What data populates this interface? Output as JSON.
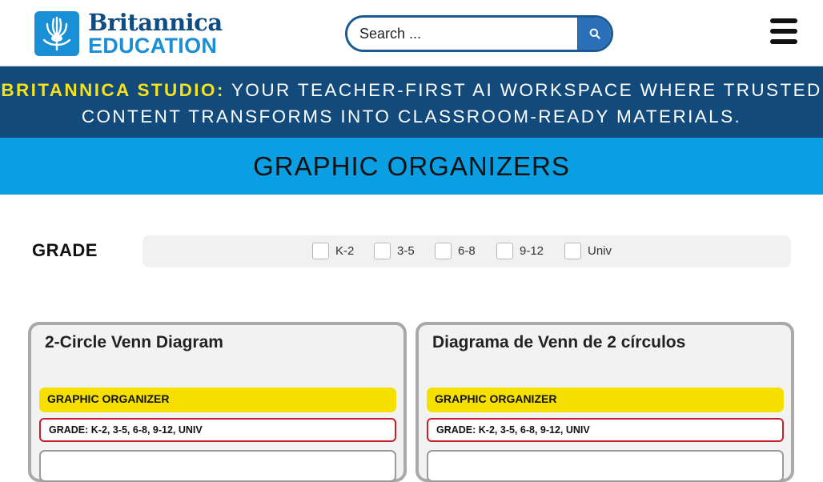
{
  "header": {
    "logo": {
      "line1": "Britannica",
      "line2": "EDUCATION",
      "icon": "britannica-thistle-logo"
    },
    "search": {
      "placeholder": "Search ...",
      "button_icon": "search-icon"
    },
    "menu_icon": "hamburger-menu-icon"
  },
  "banner": {
    "highlight": "BRITANNICA STUDIO:",
    "text": " YOUR TEACHER-FIRST AI WORKSPACE WHERE TRUSTED CONTENT TRANSFORMS INTO CLASSROOM-READY MATERIALS."
  },
  "page_title": "GRAPHIC ORGANIZERS",
  "filters": {
    "label": "GRADE",
    "options": [
      {
        "label": "K-2",
        "checked": false
      },
      {
        "label": "3-5",
        "checked": false
      },
      {
        "label": "6-8",
        "checked": false
      },
      {
        "label": "9-12",
        "checked": false
      },
      {
        "label": "Univ",
        "checked": false
      }
    ]
  },
  "cards": [
    {
      "title": "2-Circle Venn Diagram",
      "type_tag": "GRAPHIC ORGANIZER",
      "grade_tag": "GRADE: K-2, 3-5, 6-8, 9-12, UNIV"
    },
    {
      "title": "Diagrama de Venn de 2 círculos",
      "type_tag": "GRAPHIC ORGANIZER",
      "grade_tag": "GRADE: K-2, 3-5, 6-8, 9-12, UNIV"
    }
  ],
  "colors": {
    "banner_bg": "#124a7c",
    "banner_highlight": "#f7e218",
    "title_band_bg": "#0a9ee2",
    "tag_yellow": "#f5e000",
    "tag_red_border": "#c8202a",
    "brand_blue": "#1b8fd6"
  }
}
